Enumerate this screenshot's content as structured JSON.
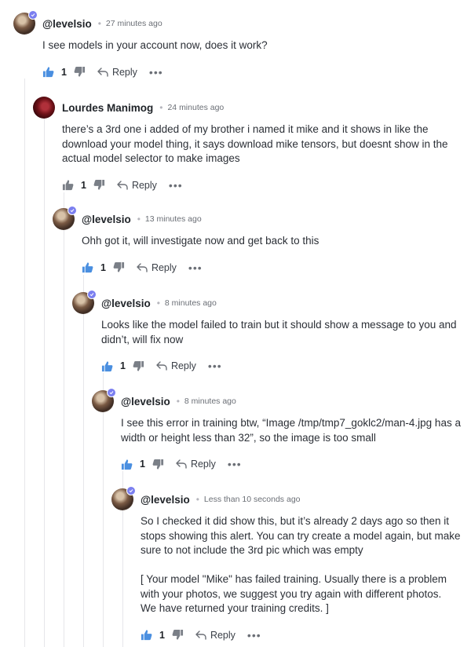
{
  "colors": {
    "like_active": "#4a8fe0",
    "icon_gray": "#7a7f87",
    "verified_badge": "#7b7ff0"
  },
  "comments": [
    {
      "username": "@levelsio",
      "time": "27 minutes ago",
      "text": "I see models in your account now, does it work?",
      "likes": "1",
      "reply_label": "Reply"
    },
    {
      "username": "Lourdes Manimog",
      "time": "24 minutes ago",
      "text": "there’s a 3rd one i added of my brother i named it mike and it shows in like the\ndownload your model thing, it says download mike tensors, but doesnt show in the\nactual model selector to make images",
      "likes": "1",
      "reply_label": "Reply"
    },
    {
      "username": "@levelsio",
      "time": "13 minutes ago",
      "text": "Ohh got it, will investigate now and get back to this",
      "likes": "1",
      "reply_label": "Reply"
    },
    {
      "username": "@levelsio",
      "time": "8 minutes ago",
      "text": "Looks like the model failed to train but it should show a message to you and\ndidn’t, will fix now",
      "likes": "1",
      "reply_label": "Reply"
    },
    {
      "username": "@levelsio",
      "time": "8 minutes ago",
      "text": "I see this error in training btw, “Image /tmp/tmp7_goklc2/man-4.jpg has a\nwidth or height less than 32”, so the image is too small",
      "likes": "1",
      "reply_label": "Reply"
    },
    {
      "username": "@levelsio",
      "time": "Less than 10 seconds ago",
      "text": "So I checked it did show this, but it’s already 2 days ago so then it\nstops showing this alert. You can try create a model again, but make\nsure to not include the 3rd pic which was empty\n\n[ Your model \"Mike\" has failed training. Usually there is a problem\nwith your photos, we suggest you try again with different photos.\nWe have returned your training credits. ]",
      "likes": "1",
      "reply_label": "Reply"
    }
  ]
}
